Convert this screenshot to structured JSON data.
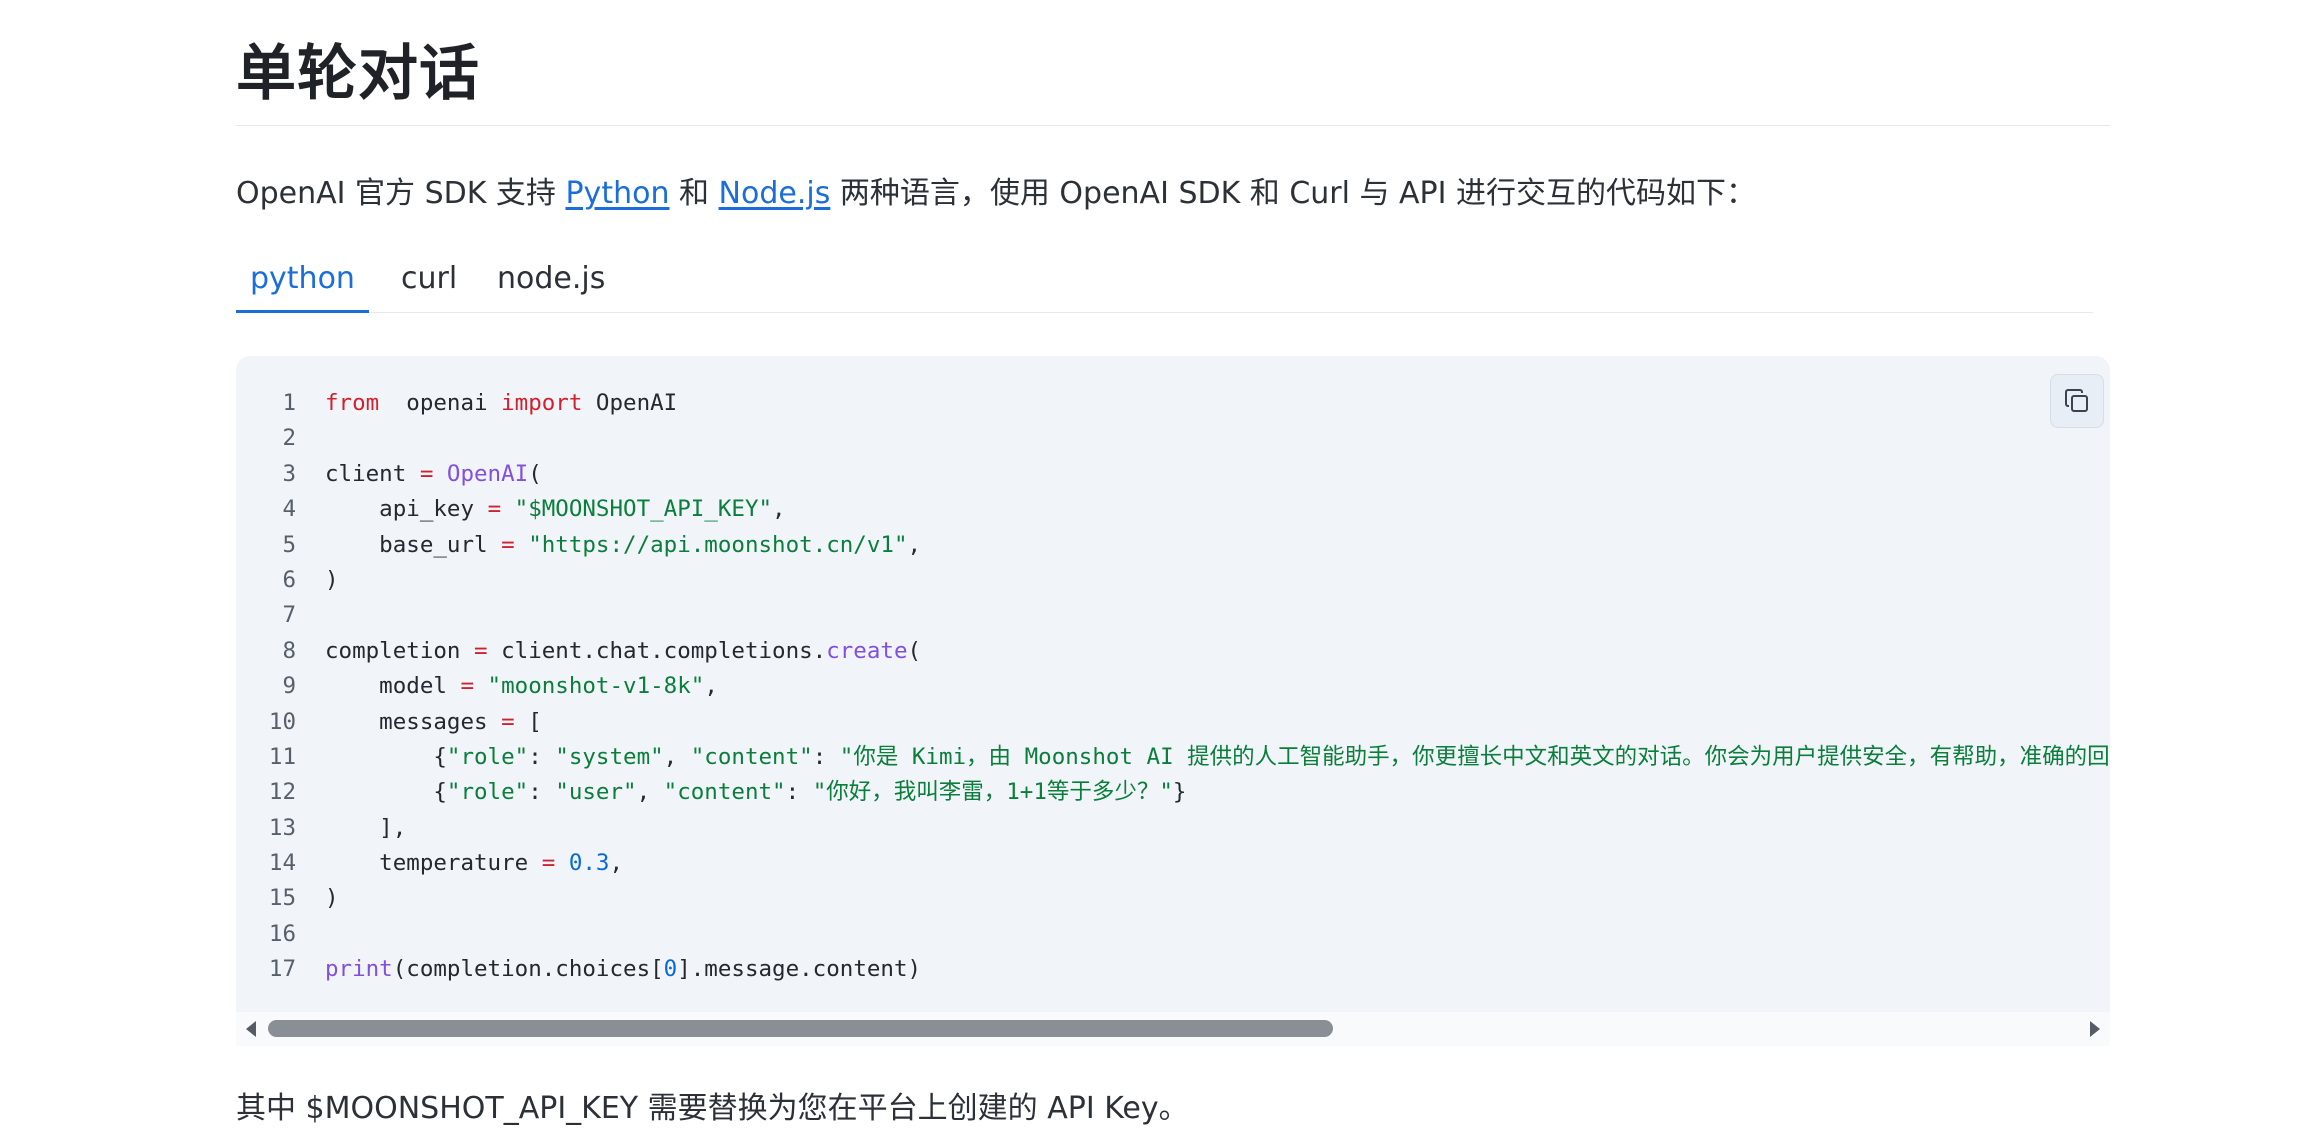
{
  "section": {
    "title": "单轮对话"
  },
  "intro": {
    "prefix": "OpenAI 官方 SDK 支持 ",
    "link_python": "Python",
    "middle": " 和 ",
    "link_node": "Node.js",
    "suffix": " 两种语言，使用 OpenAI SDK 和 Curl 与 API 进行交互的代码如下："
  },
  "tabs": [
    {
      "label": "python",
      "active": true
    },
    {
      "label": "curl",
      "active": false
    },
    {
      "label": "node.js",
      "active": false
    }
  ],
  "code": {
    "language": "python",
    "line_numbers": [
      "1",
      "2",
      "3",
      "4",
      "5",
      "6",
      "7",
      "8",
      "9",
      "10",
      "11",
      "12",
      "13",
      "14",
      "15",
      "16",
      "17"
    ],
    "lines": [
      [
        [
          "kw",
          "from"
        ],
        [
          "",
          "  openai "
        ],
        [
          "kw",
          "import"
        ],
        [
          "",
          " OpenAI"
        ]
      ],
      [],
      [
        [
          "",
          "client "
        ],
        [
          "op",
          "="
        ],
        [
          "fn",
          " OpenAI"
        ],
        [
          "",
          "("
        ]
      ],
      [
        [
          "",
          "    api_key "
        ],
        [
          "op",
          "="
        ],
        [
          "str",
          " \"$MOONSHOT_API_KEY\""
        ],
        [
          "",
          ","
        ]
      ],
      [
        [
          "",
          "    base_url "
        ],
        [
          "op",
          "="
        ],
        [
          "str",
          " \"https://api.moonshot.cn/v1\""
        ],
        [
          "",
          ","
        ]
      ],
      [
        [
          "",
          ")"
        ]
      ],
      [],
      [
        [
          "",
          "completion "
        ],
        [
          "op",
          "="
        ],
        [
          "",
          " client.chat.completions."
        ],
        [
          "fn",
          "create"
        ],
        [
          "",
          "("
        ]
      ],
      [
        [
          "",
          "    model "
        ],
        [
          "op",
          "="
        ],
        [
          "str",
          " \"moonshot-v1-8k\""
        ],
        [
          "",
          ","
        ]
      ],
      [
        [
          "",
          "    messages "
        ],
        [
          "op",
          "="
        ],
        [
          "",
          " ["
        ]
      ],
      [
        [
          "",
          "        {"
        ],
        [
          "str",
          "\"role\""
        ],
        [
          "",
          ": "
        ],
        [
          "str",
          "\"system\""
        ],
        [
          "",
          ", "
        ],
        [
          "str",
          "\"content\""
        ],
        [
          "",
          ": "
        ],
        [
          "str",
          "\"你是 Kimi，由 Moonshot AI 提供的人工智能助手，你更擅长中文和英文的对话。你会为用户提供安全，有帮助，准确的回答。"
        ]
      ],
      [
        [
          "",
          "        {"
        ],
        [
          "str",
          "\"role\""
        ],
        [
          "",
          ": "
        ],
        [
          "str",
          "\"user\""
        ],
        [
          "",
          ", "
        ],
        [
          "str",
          "\"content\""
        ],
        [
          "",
          ": "
        ],
        [
          "str",
          "\"你好，我叫李雷，1+1等于多少？\""
        ],
        [
          "",
          "}"
        ]
      ],
      [
        [
          "",
          "    ],"
        ]
      ],
      [
        [
          "",
          "    temperature "
        ],
        [
          "op",
          "="
        ],
        [
          "num",
          " 0.3"
        ],
        [
          "",
          ","
        ]
      ],
      [
        [
          "",
          ")"
        ]
      ],
      [],
      [
        [
          "fn",
          "print"
        ],
        [
          "",
          "(completion.choices["
        ],
        [
          "num",
          "0"
        ],
        [
          "",
          "].message.content)"
        ]
      ]
    ]
  },
  "copy_button": {
    "icon": "copy-icon"
  },
  "footer": {
    "text": "其中 $MOONSHOT_API_KEY 需要替换为您在平台上创建的 API Key。"
  },
  "colors": {
    "link": "#1a6ddb",
    "keyword": "#cf222e",
    "function": "#8250df",
    "string": "#0a7e3a",
    "number": "#0969da",
    "code_bg": "#f1f5f9"
  }
}
